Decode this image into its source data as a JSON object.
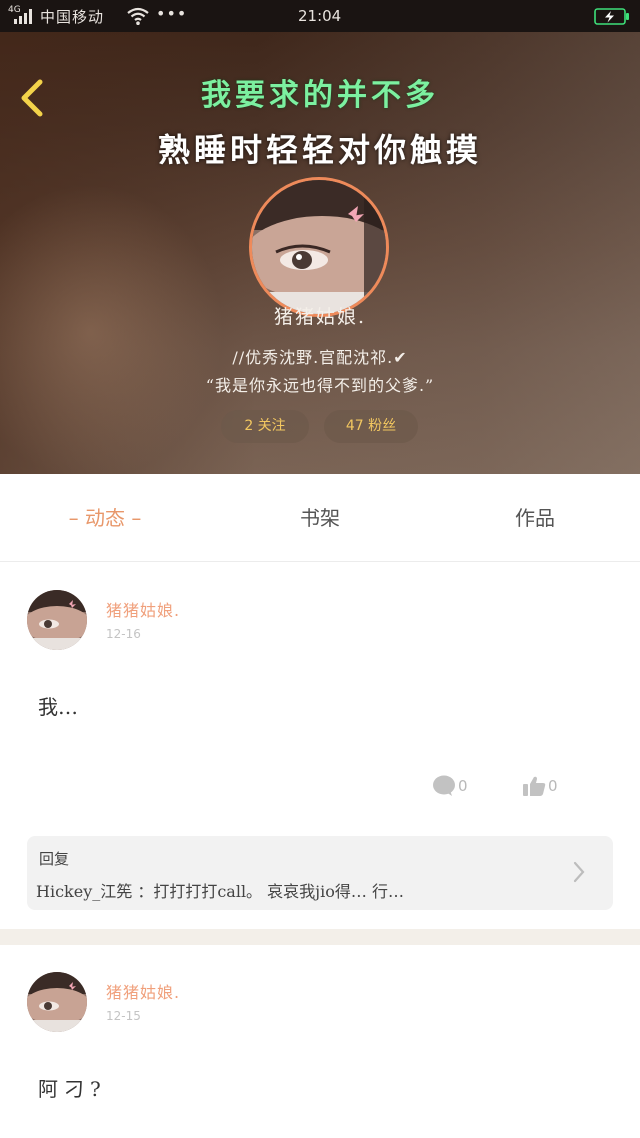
{
  "status_bar": {
    "network": "4G",
    "carrier": "中国移动",
    "more": "•••",
    "time": "21:04"
  },
  "header": {
    "title_line_1": "我要求的并不多",
    "title_line_2": "熟睡时轻轻对你触摸",
    "username": "猪猪姑娘.",
    "bio_line_1": "//优秀沈野.官配沈祁.✔",
    "bio_line_2": "“我是你永远也得不到的父爹.”",
    "following_label": "2 关注",
    "fans_label": "47 粉丝"
  },
  "tabs": [
    {
      "label": "– 动态 –"
    },
    {
      "label": "书架"
    },
    {
      "label": "作品"
    }
  ],
  "posts": [
    {
      "author": "猪猪姑娘.",
      "date": "12-16",
      "content": "我…",
      "comment_count": "0",
      "like_count": "0",
      "reply": {
        "title": "回复",
        "text": "Hickey_江筅 ：打打打打call。 哀哀我jio得… 行…"
      }
    },
    {
      "author": "猪猪姑娘.",
      "date": "12-15",
      "content": "阿刁?"
    }
  ],
  "colors": {
    "accent_orange": "#e8976a",
    "author_orange": "#f0a07c",
    "title_green": "#7cf0a0",
    "pill_text": "#f2c760",
    "back_arrow": "#f3d34a"
  }
}
